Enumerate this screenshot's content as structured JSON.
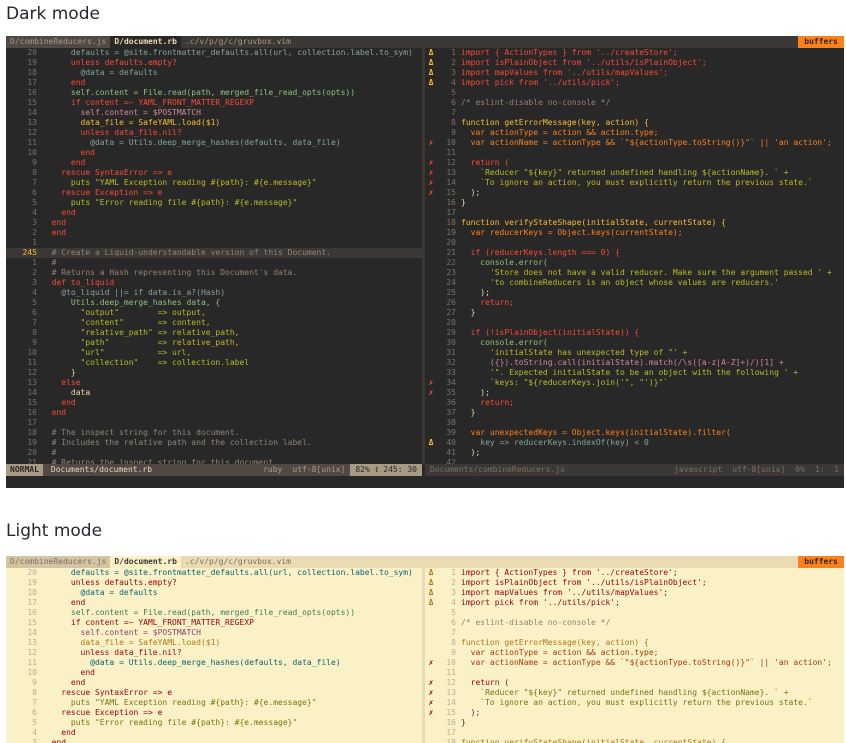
{
  "headings": {
    "dark": "Dark mode",
    "light": "Light mode"
  },
  "tabs": {
    "combine": "D/combineReducers.js",
    "document": "D/document.rb",
    "path": ".c/v/p/g/c/gruvbox.vim",
    "buffers": "buffers"
  },
  "status": {
    "mode": "NORMAL",
    "left_file": "Documents/document.rb",
    "left_ft": "ruby",
    "left_enc": "utf-8[unix]",
    "left_pos": "82% ℓ 245: 30",
    "right_file": "Documents/combineReducers.js",
    "right_ft": "javascript",
    "right_enc": "utf-8[unix]",
    "right_pct": "0%",
    "right_pos": "1:  1"
  },
  "colors": {
    "dark_bg": "#282828",
    "light_bg": "#fbf1c7",
    "accent": "#fe8019",
    "red": "#fb4934",
    "green": "#b8bb26",
    "yellow": "#fabd2f",
    "aqua": "#8ec07c",
    "blue": "#83a598",
    "purple": "#d3869b"
  },
  "left_lines": [
    {
      "n": "20",
      "t": "      defaults = @site.frontmatter_defaults.all(url, collection.label.to_sym)",
      "k": "vr"
    },
    {
      "n": "19",
      "t": "      unless defaults.empty?",
      "k": "kw"
    },
    {
      "n": "18",
      "t": "        @data = defaults",
      "k": "vr"
    },
    {
      "n": "17",
      "t": "      end",
      "k": "kw"
    },
    {
      "n": "16",
      "t": "      self.content = File.read(path, merged_file_read_opts(opts))",
      "k": "fn"
    },
    {
      "n": "15",
      "t": "      if content =~ YAML_FRONT_MATTER_REGEXP",
      "k": "kw"
    },
    {
      "n": "14",
      "t": "        self.content = $POSTMATCH",
      "k": "cn"
    },
    {
      "n": "13",
      "t": "        data_file = SafeYAML.load($1)",
      "k": "ty"
    },
    {
      "n": "12",
      "t": "        unless data_file.nil?",
      "k": "kw"
    },
    {
      "n": "11",
      "t": "          @data = Utils.deep_merge_hashes(defaults, data_file)",
      "k": "vr"
    },
    {
      "n": "10",
      "t": "        end",
      "k": "kw"
    },
    {
      "n": "9",
      "t": "      end",
      "k": "kw"
    },
    {
      "n": "8",
      "t": "    rescue SyntaxError => e",
      "k": "kw"
    },
    {
      "n": "7",
      "t": "      puts \"YAML Exception reading #{path}: #{e.message}\"",
      "k": "str"
    },
    {
      "n": "6",
      "t": "    rescue Exception => e",
      "k": "kw"
    },
    {
      "n": "5",
      "t": "      puts \"Error reading file #{path}: #{e.message}\"",
      "k": "str"
    },
    {
      "n": "4",
      "t": "    end",
      "k": "kw"
    },
    {
      "n": "3",
      "t": "  end",
      "k": "kw"
    },
    {
      "n": "2",
      "t": "  end",
      "k": "kw"
    },
    {
      "n": "1",
      "t": "",
      "k": ""
    },
    {
      "n": "245",
      "t": "  # Create a Liquid-understandable version of this Document.",
      "k": "cm",
      "cur": true
    },
    {
      "n": "1",
      "t": "  #",
      "k": "cm"
    },
    {
      "n": "2",
      "t": "  # Returns a Hash representing this Document's data.",
      "k": "cm"
    },
    {
      "n": "3",
      "t": "  def to_liquid",
      "k": "kw"
    },
    {
      "n": "4",
      "t": "    @to_liquid ||= if data.is_a?(Hash)",
      "k": "vr"
    },
    {
      "n": "5",
      "t": "      Utils.deep_merge_hashes data, {",
      "k": "fn"
    },
    {
      "n": "6",
      "t": "        \"output\"        => output,",
      "k": "str"
    },
    {
      "n": "7",
      "t": "        \"content\"       => content,",
      "k": "str"
    },
    {
      "n": "8",
      "t": "        \"relative_path\" => relative_path,",
      "k": "str"
    },
    {
      "n": "9",
      "t": "        \"path\"          => relative_path,",
      "k": "str"
    },
    {
      "n": "10",
      "t": "        \"url\"           => url,",
      "k": "str"
    },
    {
      "n": "11",
      "t": "        \"collection\"    => collection.label",
      "k": "str"
    },
    {
      "n": "12",
      "t": "      }",
      "k": ""
    },
    {
      "n": "13",
      "t": "    else",
      "k": "kw"
    },
    {
      "n": "14",
      "t": "      data",
      "k": ""
    },
    {
      "n": "15",
      "t": "    end",
      "k": "kw"
    },
    {
      "n": "16",
      "t": "  end",
      "k": "kw"
    },
    {
      "n": "17",
      "t": "",
      "k": ""
    },
    {
      "n": "18",
      "t": "  # The inspect string for this document.",
      "k": "cm"
    },
    {
      "n": "19",
      "t": "  # Includes the relative path and the collection label.",
      "k": "cm"
    },
    {
      "n": "20",
      "t": "  #",
      "k": "cm"
    },
    {
      "n": "21",
      "t": "  # Returns the inspect string for this document.",
      "k": "cm"
    }
  ],
  "right_lines": [
    {
      "s": "Δ",
      "sk": "warn",
      "n": "1",
      "t": "import { ActionTypes } from '../createStore';",
      "k": "kw"
    },
    {
      "s": "Δ",
      "sk": "warn",
      "n": "2",
      "t": "import isPlainObject from '../utils/isPlainObject';",
      "k": "kw"
    },
    {
      "s": "Δ",
      "sk": "warn",
      "n": "3",
      "t": "import mapValues from '../utils/mapValues';",
      "k": "kw"
    },
    {
      "s": "Δ",
      "sk": "warn",
      "n": "4",
      "t": "import pick from '../utils/pick';",
      "k": "kw"
    },
    {
      "s": "",
      "sk": "",
      "n": "5",
      "t": "",
      "k": ""
    },
    {
      "s": "",
      "sk": "",
      "n": "6",
      "t": "/* eslint-disable no-console */",
      "k": "cm"
    },
    {
      "s": "",
      "sk": "",
      "n": "7",
      "t": "",
      "k": ""
    },
    {
      "s": "",
      "sk": "",
      "n": "8",
      "t": "function getErrorMessage(key, action) {",
      "k": "ty"
    },
    {
      "s": "",
      "sk": "",
      "n": "9",
      "t": "  var actionType = action && action.type;",
      "k": "op"
    },
    {
      "s": "✗",
      "sk": "",
      "n": "10",
      "t": "  var actionName = actionType && `\"${actionType.toString()}\"` || 'an action';",
      "k": "op"
    },
    {
      "s": "",
      "sk": "",
      "n": "11",
      "t": "",
      "k": ""
    },
    {
      "s": "✗",
      "sk": "",
      "n": "12",
      "t": "  return (",
      "k": "kw"
    },
    {
      "s": "✗",
      "sk": "",
      "n": "13",
      "t": "    `Reducer \"${key}\" returned undefined handling ${actionName}. ` +",
      "k": "str"
    },
    {
      "s": "✗",
      "sk": "",
      "n": "14",
      "t": "    `To ignore an action, you must explicitly return the previous state.`",
      "k": "str"
    },
    {
      "s": "✗",
      "sk": "",
      "n": "15",
      "t": "  );",
      "k": ""
    },
    {
      "s": "",
      "sk": "",
      "n": "16",
      "t": "}",
      "k": ""
    },
    {
      "s": "",
      "sk": "",
      "n": "17",
      "t": "",
      "k": ""
    },
    {
      "s": "",
      "sk": "",
      "n": "18",
      "t": "function verifyStateShape(initialState, currentState) {",
      "k": "ty"
    },
    {
      "s": "",
      "sk": "",
      "n": "19",
      "t": "  var reducerKeys = Object.keys(currentState);",
      "k": "op"
    },
    {
      "s": "",
      "sk": "",
      "n": "20",
      "t": "",
      "k": ""
    },
    {
      "s": "",
      "sk": "",
      "n": "21",
      "t": "  if (reducerKeys.length === 0) {",
      "k": "kw"
    },
    {
      "s": "",
      "sk": "",
      "n": "22",
      "t": "    console.error(",
      "k": "fn"
    },
    {
      "s": "",
      "sk": "",
      "n": "23",
      "t": "      'Store does not have a valid reducer. Make sure the argument passed ' +",
      "k": "str"
    },
    {
      "s": "",
      "sk": "",
      "n": "24",
      "t": "      'to combineReducers is an object whose values are reducers.'",
      "k": "str"
    },
    {
      "s": "",
      "sk": "",
      "n": "25",
      "t": "    );",
      "k": ""
    },
    {
      "s": "",
      "sk": "",
      "n": "26",
      "t": "    return;",
      "k": "kw"
    },
    {
      "s": "",
      "sk": "",
      "n": "27",
      "t": "  }",
      "k": ""
    },
    {
      "s": "",
      "sk": "",
      "n": "28",
      "t": "",
      "k": ""
    },
    {
      "s": "",
      "sk": "",
      "n": "29",
      "t": "  if (!isPlainObject(initialState)) {",
      "k": "kw"
    },
    {
      "s": "",
      "sk": "",
      "n": "30",
      "t": "    console.error(",
      "k": "fn"
    },
    {
      "s": "",
      "sk": "",
      "n": "31",
      "t": "      'initialState has unexpected type of \"' +",
      "k": "str"
    },
    {
      "s": "",
      "sk": "",
      "n": "32",
      "t": "      ({}).toString.call(initialState).match(/\\s([a-z|A-Z]+)/)[1] +",
      "k": "cn"
    },
    {
      "s": "",
      "sk": "",
      "n": "33",
      "t": "      '\". Expected initialState to be an object with the following ' +",
      "k": "str"
    },
    {
      "s": "✗",
      "sk": "",
      "n": "34",
      "t": "      `keys: \"${reducerKeys.join('\", \"')}\"`",
      "k": "str"
    },
    {
      "s": "✗",
      "sk": "",
      "n": "35",
      "t": "    );",
      "k": ""
    },
    {
      "s": "",
      "sk": "",
      "n": "36",
      "t": "    return;",
      "k": "kw"
    },
    {
      "s": "",
      "sk": "",
      "n": "37",
      "t": "  }",
      "k": ""
    },
    {
      "s": "",
      "sk": "",
      "n": "38",
      "t": "",
      "k": ""
    },
    {
      "s": "",
      "sk": "",
      "n": "39",
      "t": "  var unexpectedKeys = Object.keys(initialState).filter(",
      "k": "op"
    },
    {
      "s": "Δ",
      "sk": "warn",
      "n": "40",
      "t": "    key => reducerKeys.indexOf(key) < 0",
      "k": "vr"
    },
    {
      "s": "",
      "sk": "",
      "n": "41",
      "t": "  );",
      "k": ""
    },
    {
      "s": "",
      "sk": "",
      "n": "42",
      "t": "",
      "k": ""
    }
  ]
}
